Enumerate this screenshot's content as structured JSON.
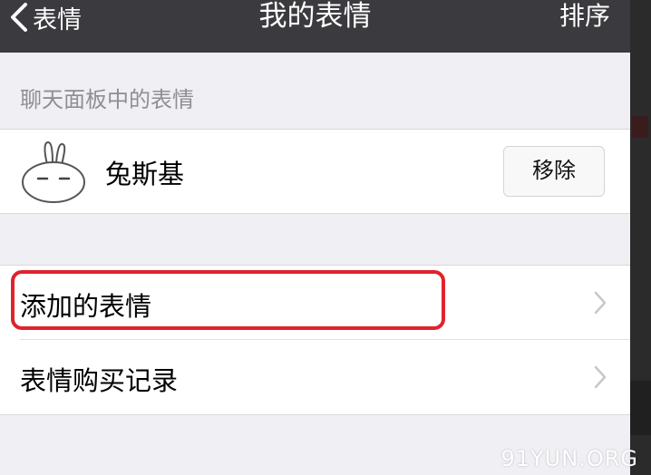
{
  "nav": {
    "back_label": "表情",
    "title": "我的表情",
    "right_label": "排序"
  },
  "section": {
    "header": "聊天面板中的表情"
  },
  "sticker": {
    "name": "兔斯基",
    "remove_label": "移除"
  },
  "menu": {
    "items": [
      {
        "label": "添加的表情"
      },
      {
        "label": "表情购买记录"
      }
    ]
  },
  "watermark": "91YUN.ORG",
  "colors": {
    "navbar": "#3a3a3f",
    "background": "#efeff4",
    "highlight": "#e0232d"
  }
}
